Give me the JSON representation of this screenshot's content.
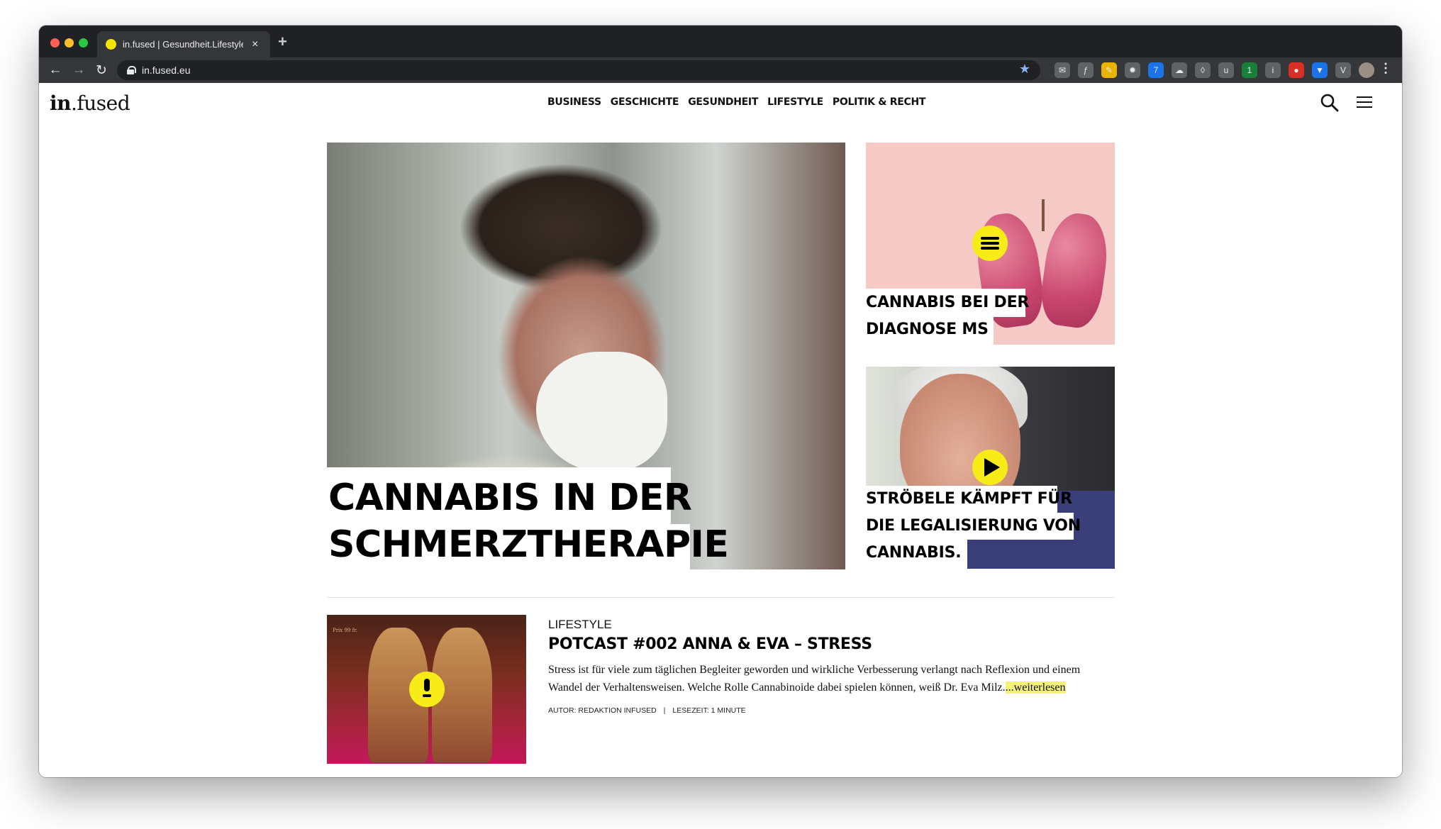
{
  "browser": {
    "tab_title": "in.fused | Gesundheit.Lifestyle",
    "tab_close": "×",
    "new_tab": "+",
    "url": "in.fused.eu",
    "back": "←",
    "forward": "→",
    "reload": "↻",
    "bookmark": "★",
    "menu": "⋮",
    "extensions": [
      "mail-icon",
      "f?",
      "pencil-icon",
      "gear-icon",
      "7",
      "cloud-icon",
      "shield-icon",
      "ublock-icon",
      "1",
      "info-icon",
      "red-extension-icon",
      "blue-extension-icon",
      "v-icon",
      "profile-avatar"
    ]
  },
  "site": {
    "logo_bold": "in",
    "logo_rest": ".fused",
    "nav": [
      "BUSINESS",
      "GESCHICHTE",
      "GESUNDHEIT",
      "LIFESTYLE",
      "POLITIK & RECHT"
    ]
  },
  "hero": {
    "line1": "CANNABIS IN DER",
    "line2": "SCHMERZTHERAPIE"
  },
  "cards": {
    "ms": {
      "line1": "CANNABIS BEI DER",
      "line2": "DIAGNOSE MS",
      "badge": "article-icon"
    },
    "stroebele": {
      "line1": "STRÖBELE KÄMPFT FÜR",
      "line2": "DIE LEGALISIERUNG VON",
      "line3": "CANNABIS.",
      "badge": "play-icon"
    }
  },
  "article": {
    "thumb_caption": "Prix 99 fr.",
    "category": "LIFESTYLE",
    "title": "POTCAST #002 ANNA & EVA – STRESS",
    "excerpt": "Stress ist für viele zum täglichen Begleiter geworden und wirkliche Verbesserung verlangt nach Reflexion und einem Wandel der Verhaltensweisen. Welche Rolle Cannabinoide dabei spielen können, weiß Dr. Eva Milz.",
    "read_more": "...weiterlesen",
    "author": "AUTOR: REDAKTION INFUSED",
    "separator": "|",
    "reading_time": "LESEZEIT: 1 MINUTE",
    "badge": "microphone-icon"
  },
  "colors": {
    "accent_yellow": "#f7ec17",
    "browser_dark": "#202124",
    "highlight": "#f4f27a"
  }
}
